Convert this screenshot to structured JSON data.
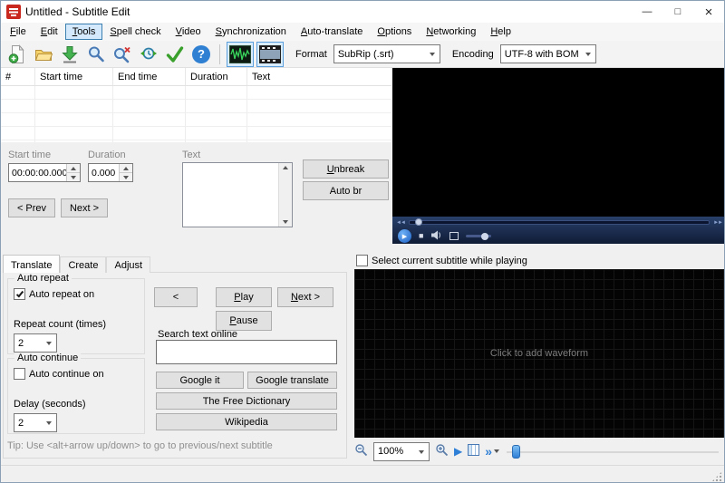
{
  "window": {
    "title": "Untitled - Subtitle Edit",
    "minimize_glyph": "—",
    "maximize_glyph": "□",
    "close_glyph": "×"
  },
  "menu": {
    "items": [
      "File",
      "Edit",
      "Tools",
      "Spell check",
      "Video",
      "Synchronization",
      "Auto-translate",
      "Options",
      "Networking",
      "Help"
    ],
    "active_item": "Tools"
  },
  "toolbar": {
    "icons": [
      "new-file",
      "open-file",
      "save",
      "find",
      "replace",
      "visual-sync",
      "spell-check",
      "help",
      "waveform-toggle",
      "video-toggle"
    ],
    "help_glyph": "?",
    "format_label": "Format",
    "format_value": "SubRip (.srt)",
    "encoding_label": "Encoding",
    "encoding_value": "UTF-8 with BOM"
  },
  "subtitle_list": {
    "columns": [
      "#",
      "Start time",
      "End time",
      "Duration",
      "Text"
    ],
    "rows": []
  },
  "edit_panel": {
    "start_time_label": "Start time",
    "start_time_value": "00:00:00.000",
    "duration_label": "Duration",
    "duration_value": "0.000",
    "text_label": "Text",
    "unbreak_button": "Unbreak",
    "auto_br_button": "Auto br",
    "prev_button": "< Prev",
    "next_button": "Next >"
  },
  "video_player": {
    "rewind_glyph": "◄◄",
    "forward_glyph": "►►",
    "play_glyph": "▶",
    "stop_glyph": "■"
  },
  "bottom_tabs": {
    "items": [
      "Translate",
      "Create",
      "Adjust"
    ],
    "active_item": "Translate"
  },
  "translate_tab": {
    "auto_repeat": {
      "title": "Auto repeat",
      "checkbox_label": "Auto repeat on",
      "checked": true,
      "count_label": "Repeat count (times)",
      "count_value": "2"
    },
    "auto_continue": {
      "title": "Auto continue",
      "checkbox_label": "Auto continue on",
      "checked": false,
      "delay_label": "Delay (seconds)",
      "delay_value": "2"
    },
    "controls": {
      "back_button": "<",
      "play_button": "Play",
      "next_button": "Next >",
      "pause_button": "Pause"
    },
    "search": {
      "label": "Search text online",
      "input_value": "",
      "buttons": [
        "Google it",
        "Google translate",
        "The Free Dictionary",
        "Wikipedia"
      ]
    },
    "tip": "Tip: Use <alt+arrow up/down> to go to previous/next subtitle"
  },
  "waveform": {
    "checkbox_label": "Select current subtitle while playing",
    "checked": false,
    "placeholder_text": "Click to add waveform",
    "zoom_value": "100%",
    "play_glyph": "▶",
    "fast_forward_glyph": "»"
  }
}
